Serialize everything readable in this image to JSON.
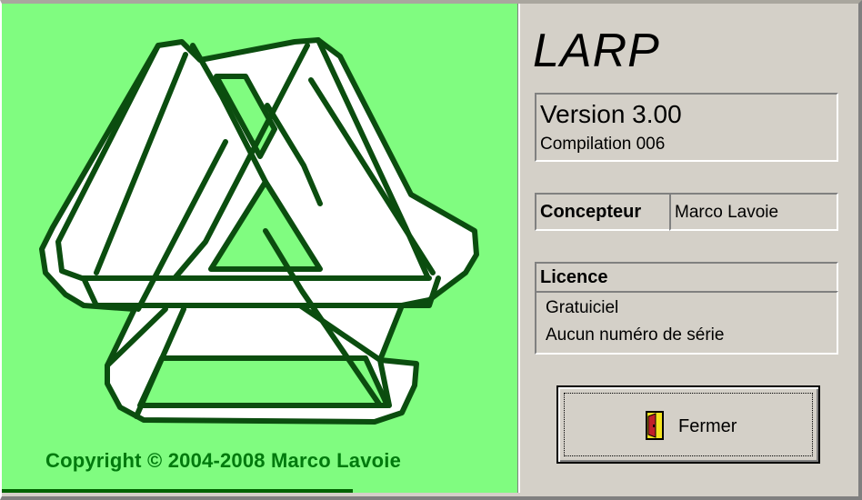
{
  "splash": {
    "copyright": "Copyright © 2004-2008  Marco Lavoie",
    "progress_fraction": 0.68
  },
  "logo": {
    "icon": "triangle-knot-logo",
    "stroke_color": "#0b4d0f",
    "fill_color": "#ffffff"
  },
  "about": {
    "app_name": "LARP",
    "version": "Version 3.00",
    "build": "Compilation 006",
    "designer_label": "Concepteur",
    "designer_value": "Marco Lavoie",
    "license_label": "Licence",
    "license_lines": [
      "Gratuiciel",
      "Aucun numéro de série"
    ],
    "close_label": "Fermer",
    "close_icon": "door-icon"
  },
  "colors": {
    "panel_green": "#80fc80",
    "text_green": "#007a0d",
    "dialog_gray": "#d4d0c8"
  }
}
